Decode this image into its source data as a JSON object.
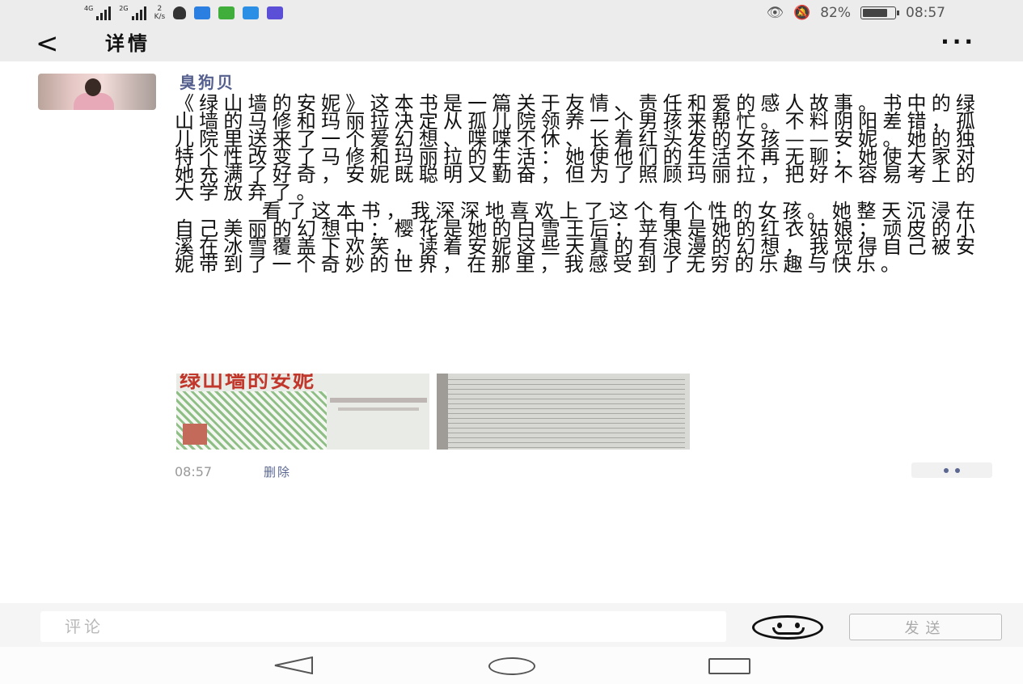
{
  "status_bar": {
    "signal1_label": "4G",
    "signal2_label": "2G",
    "net_speed_value": "2",
    "net_speed_unit": "K/s",
    "battery_percent": "82%",
    "battery_level": 0.82,
    "time": "08:57"
  },
  "header": {
    "title": "详情"
  },
  "post": {
    "username": "臭狗贝",
    "paragraph1": "《绿山墙的安妮》这本书是一篇关于友情、责任和爱的感人故事。书中的绿山墙的马修和玛丽拉决定从孤儿院领养一个男孩来帮忙。不料阴阳差错，孤儿院里送来了一个爱幻想、喋喋不休、长着红头发的女孩——安妮。她的独特个性改变了马修和玛丽拉的生活：她使他们的生活不再无聊；她使大家对她充满了好奇，安妮既聪明又勤奋，但为了照顾玛丽拉，把好不容易考上的大学放弃了。",
    "paragraph2": "看了这本书，我深深地喜欢上了这个有个性的女孩。她整天沉浸在自己美丽的幻想中：樱花是她的白雪王后；苹果是她的红衣姑娘；顽皮的小溪在冰雪覆盖下欢笑，读着安妮这些天真的有浪漫的幻想，我觉得自己被安妮带到了一个奇妙的世界，在那里，我感受到了无穷的乐趣与快乐。",
    "photo1_title": "绿山墙的安妮",
    "time": "08:57",
    "delete_label": "删除"
  },
  "comment_bar": {
    "placeholder": "评论",
    "send_label": "发送"
  },
  "colors": {
    "username": "#55608f",
    "link": "#5b6791",
    "bar_bg": "#ececec"
  }
}
